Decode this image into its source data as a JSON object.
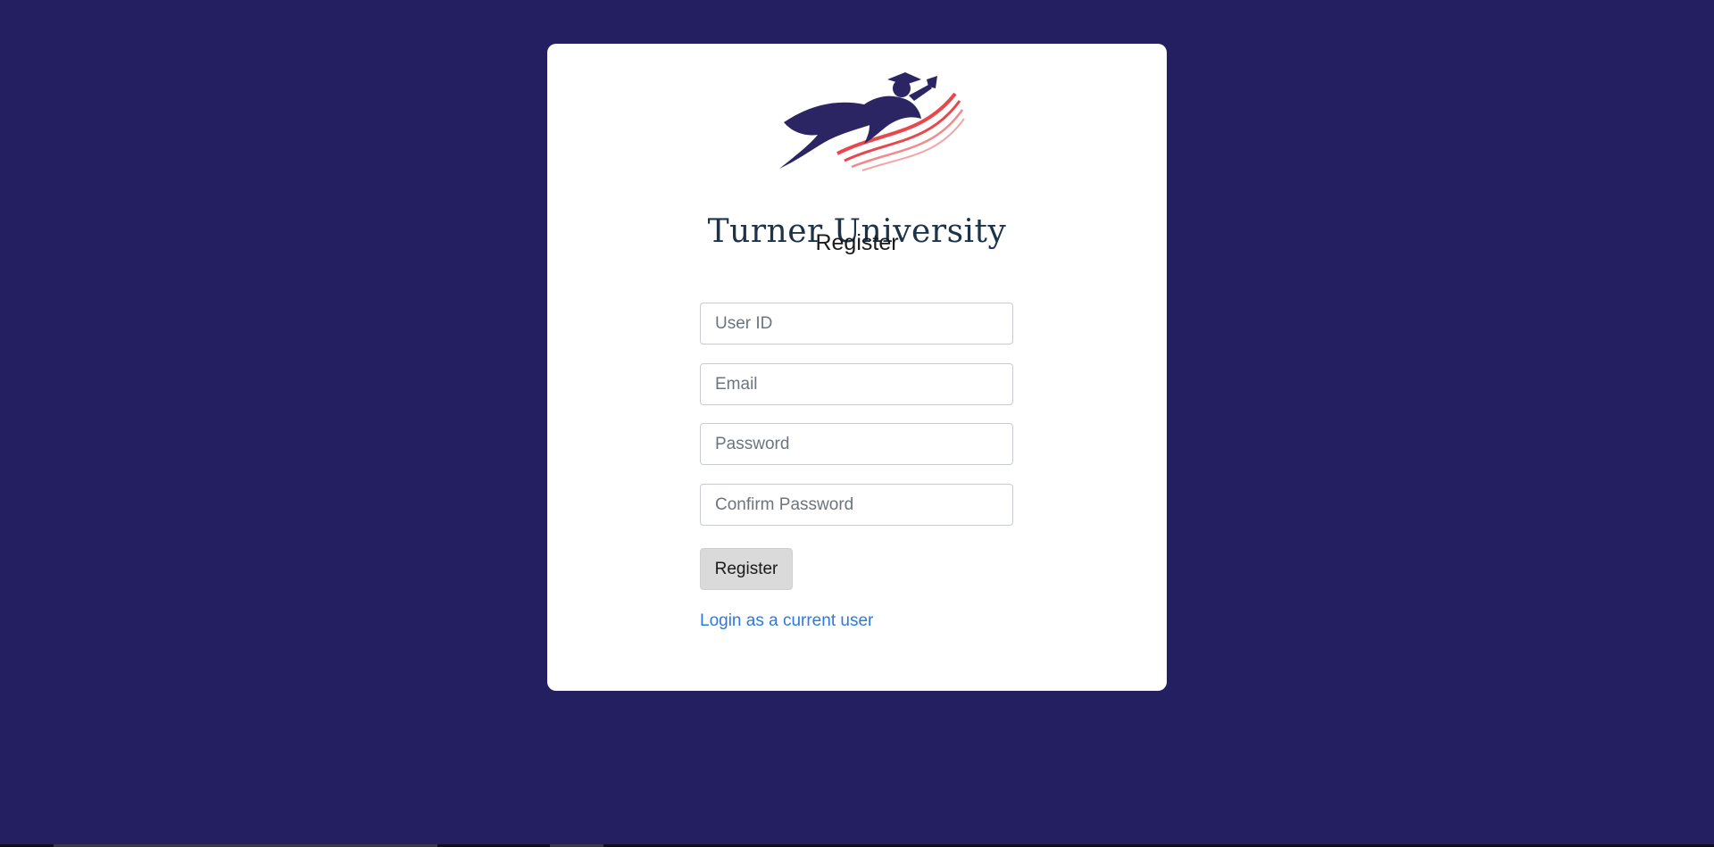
{
  "brand": {
    "name": "Turner University",
    "logo_icon": "graduate-runner-icon",
    "accent_colors": [
      "#2b2563",
      "#e8474c"
    ]
  },
  "page": {
    "background_color": "#241f60",
    "title": "Register"
  },
  "form": {
    "user_id": {
      "value": "",
      "placeholder": "User ID"
    },
    "email": {
      "value": "",
      "placeholder": "Email"
    },
    "password": {
      "value": "",
      "placeholder": "Password"
    },
    "confirm_password": {
      "value": "",
      "placeholder": "Confirm Password"
    },
    "submit_label": "Register",
    "login_link_label": "Login as a current user",
    "link_color": "#2a7ae2"
  }
}
